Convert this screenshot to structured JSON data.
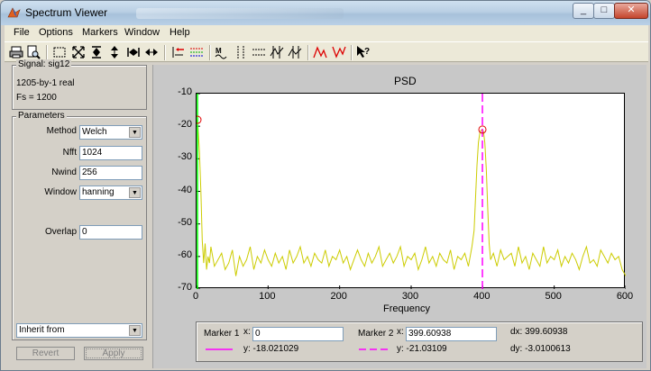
{
  "window": {
    "title": "Spectrum Viewer"
  },
  "menu": [
    "File",
    "Options",
    "Markers",
    "Window",
    "Help"
  ],
  "toolbar_icons": [
    "print-icon",
    "print-preview-icon",
    "zoom-box-icon",
    "zoom-full-icon",
    "zoom-y-icon",
    "zoom-y-in-icon",
    "zoom-x-icon",
    "zoom-x-in-icon",
    "mouse-zoom-icon",
    "cross-marker-icon",
    "marker-line-icon",
    "marker-settings-icon",
    "vertical-markers-icon",
    "horizontal-markers-icon",
    "track-markers-icon",
    "slope-markers-icon",
    "peaks-icon",
    "valleys-icon",
    "whats-this-icon"
  ],
  "signal": {
    "legend": "Signal: sig12",
    "size": "1205-by-1 real",
    "fs": "Fs = 1200"
  },
  "params": {
    "legend": "Parameters",
    "method_label": "Method",
    "method_value": "Welch",
    "nfft_label": "Nfft",
    "nfft_value": "1024",
    "nwind_label": "Nwind",
    "nwind_value": "256",
    "window_label": "Window",
    "window_value": "hanning",
    "overlap_label": "Overlap",
    "overlap_value": "0",
    "inherit_value": "Inherit from",
    "revert_label": "Revert",
    "apply_label": "Apply"
  },
  "readout": {
    "m1_label": "Marker 1",
    "x_label": "x:",
    "m1_x": "0",
    "m1_y": "y: -18.021029",
    "m2_label": "Marker 2",
    "m2_x": "399.60938",
    "m2_y": "y: -21.03109",
    "dx": "dx: 399.60938",
    "dy": "dy: -3.0100613"
  },
  "chart_data": {
    "type": "line",
    "title": "PSD",
    "xlabel": "Frequency",
    "ylabel": "",
    "xlim": [
      0,
      600
    ],
    "ylim": [
      -70,
      -10
    ],
    "xticks": [
      0,
      100,
      200,
      300,
      400,
      500,
      600
    ],
    "yticks": [
      -10,
      -20,
      -30,
      -40,
      -50,
      -60,
      -70
    ],
    "line_color": "#cccc00",
    "markers": [
      {
        "name": "Marker 1",
        "x": 0,
        "y": -18.021029,
        "color": "#00ff00"
      },
      {
        "name": "Marker 2",
        "x": 399.60938,
        "y": -21.03109,
        "color": "#ff00ff"
      }
    ],
    "series": [
      {
        "x": [
          0,
          2,
          4,
          6,
          8,
          10,
          12,
          14,
          16,
          18,
          20,
          25,
          30,
          35,
          40,
          45,
          50,
          55,
          60,
          65,
          70,
          75,
          80,
          85,
          90,
          95,
          100,
          105,
          110,
          115,
          120,
          125,
          130,
          135,
          140,
          145,
          150,
          155,
          160,
          165,
          170,
          175,
          180,
          185,
          190,
          195,
          200,
          205,
          210,
          215,
          220,
          225,
          230,
          235,
          240,
          245,
          250,
          255,
          260,
          265,
          270,
          275,
          280,
          285,
          290,
          295,
          300,
          305,
          310,
          315,
          320,
          325,
          330,
          335,
          340,
          345,
          350,
          355,
          360,
          365,
          370,
          375,
          380,
          385,
          388,
          390,
          392,
          394,
          396,
          398,
          399.6,
          401,
          403,
          405,
          407,
          409,
          411,
          415,
          420,
          425,
          430,
          435,
          440,
          445,
          450,
          455,
          460,
          465,
          470,
          475,
          480,
          485,
          490,
          495,
          500,
          505,
          510,
          515,
          520,
          525,
          530,
          535,
          540,
          545,
          550,
          555,
          560,
          565,
          570,
          575,
          580,
          585,
          590,
          595,
          600
        ],
        "y": [
          -18.0,
          -20.5,
          -28,
          -40,
          -55,
          -62,
          -56,
          -64,
          -60,
          -62,
          -57,
          -63,
          -61,
          -59,
          -64,
          -62,
          -58,
          -66,
          -60,
          -63,
          -61,
          -57,
          -64,
          -60,
          -62,
          -58,
          -61,
          -63,
          -59,
          -62,
          -60,
          -64,
          -58,
          -62,
          -60,
          -57,
          -62,
          -60,
          -63,
          -59,
          -61,
          -62,
          -58,
          -63,
          -60,
          -61,
          -58,
          -62,
          -60,
          -64,
          -61,
          -58,
          -61,
          -63,
          -59,
          -62,
          -60,
          -57,
          -63,
          -61,
          -59,
          -62,
          -60,
          -57,
          -63,
          -60,
          -61,
          -59,
          -64,
          -61,
          -57,
          -62,
          -60,
          -63,
          -59,
          -61,
          -62,
          -58,
          -64,
          -60,
          -61,
          -59,
          -63,
          -57,
          -52,
          -42,
          -32,
          -25,
          -22,
          -21.2,
          -21.03,
          -21.5,
          -25,
          -33,
          -45,
          -56,
          -61,
          -59,
          -63,
          -58,
          -61,
          -60,
          -59,
          -63,
          -57,
          -62,
          -60,
          -64,
          -59,
          -61,
          -63,
          -57,
          -62,
          -60,
          -61,
          -58,
          -63,
          -60,
          -62,
          -59,
          -61,
          -64,
          -60,
          -57,
          -62,
          -61,
          -63,
          -58,
          -60,
          -62,
          -59,
          -61,
          -60,
          -64,
          -66
        ]
      }
    ]
  }
}
